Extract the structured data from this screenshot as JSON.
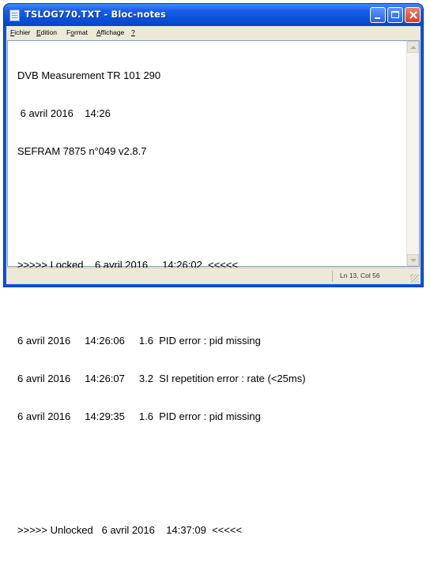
{
  "window": {
    "title": "TSLOG770.TXT - Bloc-notes",
    "icon": "notepad-icon"
  },
  "menu": [
    {
      "pre": "",
      "u": "F",
      "post": "ichier"
    },
    {
      "pre": "",
      "u": "E",
      "post": "dition"
    },
    {
      "pre": "F",
      "u": "o",
      "post": "rmat"
    },
    {
      "pre": "",
      "u": "A",
      "post": "ffichage"
    },
    {
      "pre": "",
      "u": "?",
      "post": ""
    }
  ],
  "content": {
    "lines": [
      "DVB Measurement TR 101 290",
      " 6 avril 2016    14:26",
      "SEFRAM 7875 n°049 v2.8.7",
      "",
      "",
      ">>>>> Locked    6 avril 2016     14:26:02  <<<<<",
      "",
      "6 avril 2016     14:26:06     1.6  PID error : pid missing",
      "6 avril 2016     14:26:07     3.2  SI repetition error : rate (<25ms)",
      "6 avril 2016     14:29:35     1.6  PID error : pid missing",
      "",
      "",
      ">>>>> Unlocked   6 avril 2016    14:37:09  <<<<<"
    ]
  },
  "status": {
    "position": "Ln 13, Col 56"
  }
}
